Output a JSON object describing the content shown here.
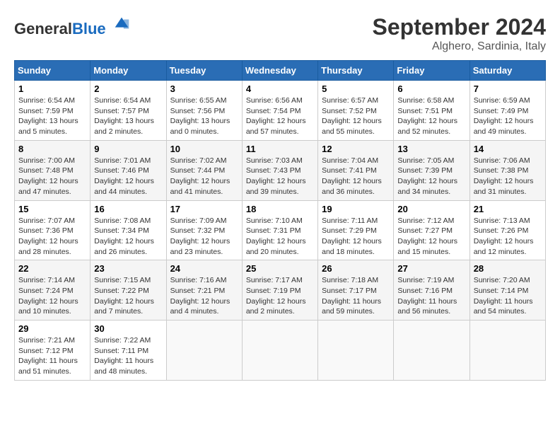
{
  "header": {
    "logo_general": "General",
    "logo_blue": "Blue",
    "month_title": "September 2024",
    "location": "Alghero, Sardinia, Italy"
  },
  "weekdays": [
    "Sunday",
    "Monday",
    "Tuesday",
    "Wednesday",
    "Thursday",
    "Friday",
    "Saturday"
  ],
  "weeks": [
    [
      {
        "day": 1,
        "sunrise": "6:54 AM",
        "sunset": "7:59 PM",
        "daylight": "13 hours and 5 minutes."
      },
      {
        "day": 2,
        "sunrise": "6:54 AM",
        "sunset": "7:57 PM",
        "daylight": "13 hours and 2 minutes."
      },
      {
        "day": 3,
        "sunrise": "6:55 AM",
        "sunset": "7:56 PM",
        "daylight": "13 hours and 0 minutes."
      },
      {
        "day": 4,
        "sunrise": "6:56 AM",
        "sunset": "7:54 PM",
        "daylight": "12 hours and 57 minutes."
      },
      {
        "day": 5,
        "sunrise": "6:57 AM",
        "sunset": "7:52 PM",
        "daylight": "12 hours and 55 minutes."
      },
      {
        "day": 6,
        "sunrise": "6:58 AM",
        "sunset": "7:51 PM",
        "daylight": "12 hours and 52 minutes."
      },
      {
        "day": 7,
        "sunrise": "6:59 AM",
        "sunset": "7:49 PM",
        "daylight": "12 hours and 49 minutes."
      }
    ],
    [
      {
        "day": 8,
        "sunrise": "7:00 AM",
        "sunset": "7:48 PM",
        "daylight": "12 hours and 47 minutes."
      },
      {
        "day": 9,
        "sunrise": "7:01 AM",
        "sunset": "7:46 PM",
        "daylight": "12 hours and 44 minutes."
      },
      {
        "day": 10,
        "sunrise": "7:02 AM",
        "sunset": "7:44 PM",
        "daylight": "12 hours and 41 minutes."
      },
      {
        "day": 11,
        "sunrise": "7:03 AM",
        "sunset": "7:43 PM",
        "daylight": "12 hours and 39 minutes."
      },
      {
        "day": 12,
        "sunrise": "7:04 AM",
        "sunset": "7:41 PM",
        "daylight": "12 hours and 36 minutes."
      },
      {
        "day": 13,
        "sunrise": "7:05 AM",
        "sunset": "7:39 PM",
        "daylight": "12 hours and 34 minutes."
      },
      {
        "day": 14,
        "sunrise": "7:06 AM",
        "sunset": "7:38 PM",
        "daylight": "12 hours and 31 minutes."
      }
    ],
    [
      {
        "day": 15,
        "sunrise": "7:07 AM",
        "sunset": "7:36 PM",
        "daylight": "12 hours and 28 minutes."
      },
      {
        "day": 16,
        "sunrise": "7:08 AM",
        "sunset": "7:34 PM",
        "daylight": "12 hours and 26 minutes."
      },
      {
        "day": 17,
        "sunrise": "7:09 AM",
        "sunset": "7:32 PM",
        "daylight": "12 hours and 23 minutes."
      },
      {
        "day": 18,
        "sunrise": "7:10 AM",
        "sunset": "7:31 PM",
        "daylight": "12 hours and 20 minutes."
      },
      {
        "day": 19,
        "sunrise": "7:11 AM",
        "sunset": "7:29 PM",
        "daylight": "12 hours and 18 minutes."
      },
      {
        "day": 20,
        "sunrise": "7:12 AM",
        "sunset": "7:27 PM",
        "daylight": "12 hours and 15 minutes."
      },
      {
        "day": 21,
        "sunrise": "7:13 AM",
        "sunset": "7:26 PM",
        "daylight": "12 hours and 12 minutes."
      }
    ],
    [
      {
        "day": 22,
        "sunrise": "7:14 AM",
        "sunset": "7:24 PM",
        "daylight": "12 hours and 10 minutes."
      },
      {
        "day": 23,
        "sunrise": "7:15 AM",
        "sunset": "7:22 PM",
        "daylight": "12 hours and 7 minutes."
      },
      {
        "day": 24,
        "sunrise": "7:16 AM",
        "sunset": "7:21 PM",
        "daylight": "12 hours and 4 minutes."
      },
      {
        "day": 25,
        "sunrise": "7:17 AM",
        "sunset": "7:19 PM",
        "daylight": "12 hours and 2 minutes."
      },
      {
        "day": 26,
        "sunrise": "7:18 AM",
        "sunset": "7:17 PM",
        "daylight": "11 hours and 59 minutes."
      },
      {
        "day": 27,
        "sunrise": "7:19 AM",
        "sunset": "7:16 PM",
        "daylight": "11 hours and 56 minutes."
      },
      {
        "day": 28,
        "sunrise": "7:20 AM",
        "sunset": "7:14 PM",
        "daylight": "11 hours and 54 minutes."
      }
    ],
    [
      {
        "day": 29,
        "sunrise": "7:21 AM",
        "sunset": "7:12 PM",
        "daylight": "11 hours and 51 minutes."
      },
      {
        "day": 30,
        "sunrise": "7:22 AM",
        "sunset": "7:11 PM",
        "daylight": "11 hours and 48 minutes."
      },
      null,
      null,
      null,
      null,
      null
    ]
  ]
}
